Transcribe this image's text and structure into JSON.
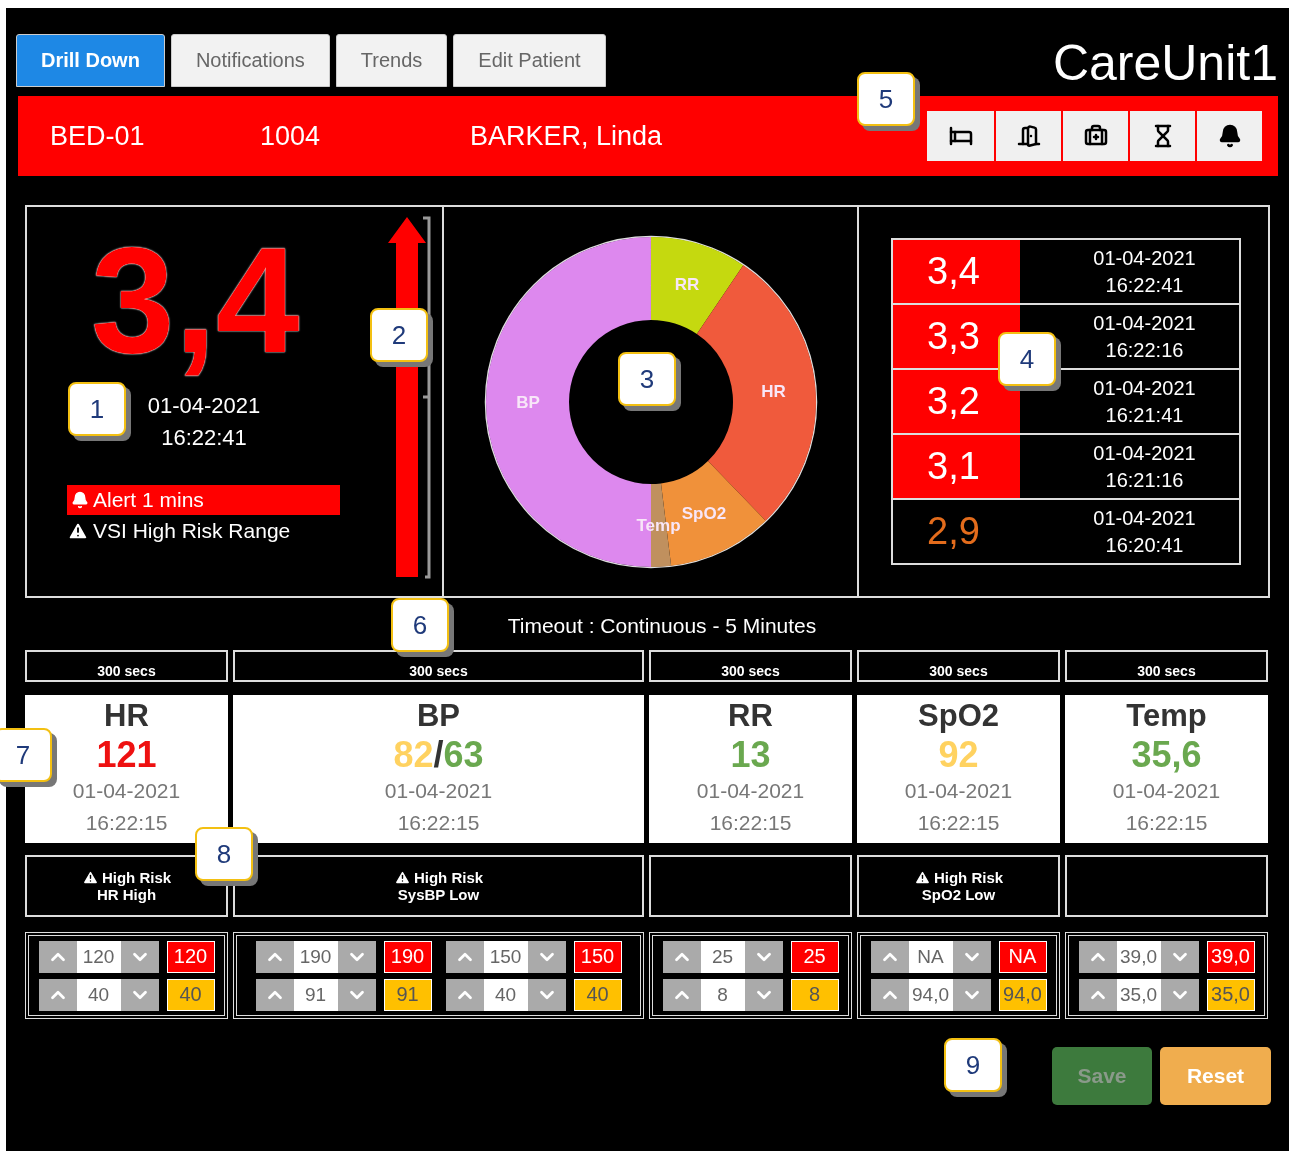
{
  "tabs": [
    {
      "label": "Drill Down",
      "selected": true
    },
    {
      "label": "Notifications",
      "selected": false
    },
    {
      "label": "Trends",
      "selected": false
    },
    {
      "label": "Edit Patient",
      "selected": false
    }
  ],
  "unit_title": "CareUnit1",
  "patient_bar": {
    "bed": "BED-01",
    "id": "1004",
    "name": "BARKER, Linda"
  },
  "score": {
    "value": "3,4",
    "date": "01-04-2021",
    "time": "16:22:41",
    "alert": "Alert 1 mins",
    "warning": "VSI High Risk Range"
  },
  "donut": {
    "segments": [
      {
        "label": "RR",
        "color": "#c5d90f"
      },
      {
        "label": "HR",
        "color": "#f05a3c"
      },
      {
        "label": "SpO2",
        "color": "#f0913a"
      },
      {
        "label": "Temp",
        "color": "#c0905e"
      },
      {
        "label": "BP",
        "color": "#dd88ee"
      }
    ]
  },
  "history": [
    {
      "score": "3,4",
      "date": "01-04-2021",
      "time": "16:22:41",
      "alert": true
    },
    {
      "score": "3,3",
      "date": "01-04-2021",
      "time": "16:22:16",
      "alert": true
    },
    {
      "score": "3,2",
      "date": "01-04-2021",
      "time": "16:21:41",
      "alert": true
    },
    {
      "score": "3,1",
      "date": "01-04-2021",
      "time": "16:21:16",
      "alert": true
    },
    {
      "score": "2,9",
      "date": "01-04-2021",
      "time": "16:20:41",
      "alert": false
    }
  ],
  "timeout": "Timeout : Continuous - 5 Minutes",
  "vitals": [
    {
      "interval": "300 secs",
      "name": "HR",
      "value_parts": [
        {
          "text": "121",
          "color": "#ee1111"
        }
      ],
      "date": "01-04-2021",
      "time": "16:22:15",
      "warning": {
        "title": "High Risk",
        "detail": "HR High"
      },
      "limit_groups": [
        [
          {
            "kind": "high",
            "input": "120",
            "badge": "120"
          },
          {
            "kind": "low",
            "input": "40",
            "badge": "40"
          }
        ]
      ]
    },
    {
      "interval": "300 secs",
      "name": "BP",
      "value_parts": [
        {
          "text": "82",
          "color": "#ffd260"
        },
        {
          "text": "/",
          "color": "#333333"
        },
        {
          "text": "63",
          "color": "#6aa84f"
        }
      ],
      "date": "01-04-2021",
      "time": "16:22:15",
      "warning": {
        "title": "High Risk",
        "detail": "SysBP Low"
      },
      "limit_groups": [
        [
          {
            "kind": "high",
            "input": "190",
            "badge": "190"
          },
          {
            "kind": "low",
            "input": "91",
            "badge": "91"
          }
        ],
        [
          {
            "kind": "high",
            "input": "150",
            "badge": "150"
          },
          {
            "kind": "low",
            "input": "40",
            "badge": "40"
          }
        ]
      ]
    },
    {
      "interval": "300 secs",
      "name": "RR",
      "value_parts": [
        {
          "text": "13",
          "color": "#6aa84f"
        }
      ],
      "date": "01-04-2021",
      "time": "16:22:15",
      "limit_groups": [
        [
          {
            "kind": "high",
            "input": "25",
            "badge": "25"
          },
          {
            "kind": "low",
            "input": "8",
            "badge": "8"
          }
        ]
      ]
    },
    {
      "interval": "300 secs",
      "name": "SpO2",
      "value_parts": [
        {
          "text": "92",
          "color": "#ffd260"
        }
      ],
      "date": "01-04-2021",
      "time": "16:22:15",
      "warning": {
        "title": "High Risk",
        "detail": "SpO2 Low"
      },
      "limit_groups": [
        [
          {
            "kind": "high",
            "input": "NA",
            "badge": "NA"
          },
          {
            "kind": "low",
            "input": "94,0",
            "badge": "94,0"
          }
        ]
      ]
    },
    {
      "interval": "300 secs",
      "name": "Temp",
      "value_parts": [
        {
          "text": "35,6",
          "color": "#6aa84f"
        }
      ],
      "date": "01-04-2021",
      "time": "16:22:15",
      "limit_groups": [
        [
          {
            "kind": "high",
            "input": "39,0",
            "badge": "39,0"
          },
          {
            "kind": "low",
            "input": "35,0",
            "badge": "35,0"
          }
        ]
      ]
    }
  ],
  "buttons": [
    {
      "label": "Save",
      "kind": "save",
      "disabled": true
    },
    {
      "label": "Reset",
      "kind": "reset",
      "disabled": false
    }
  ],
  "callouts": [
    {
      "label": "1"
    },
    {
      "label": "2"
    },
    {
      "label": "3"
    },
    {
      "label": "4"
    },
    {
      "label": "5"
    },
    {
      "label": "6"
    },
    {
      "label": "7"
    },
    {
      "label": "8"
    },
    {
      "label": "9"
    }
  ]
}
